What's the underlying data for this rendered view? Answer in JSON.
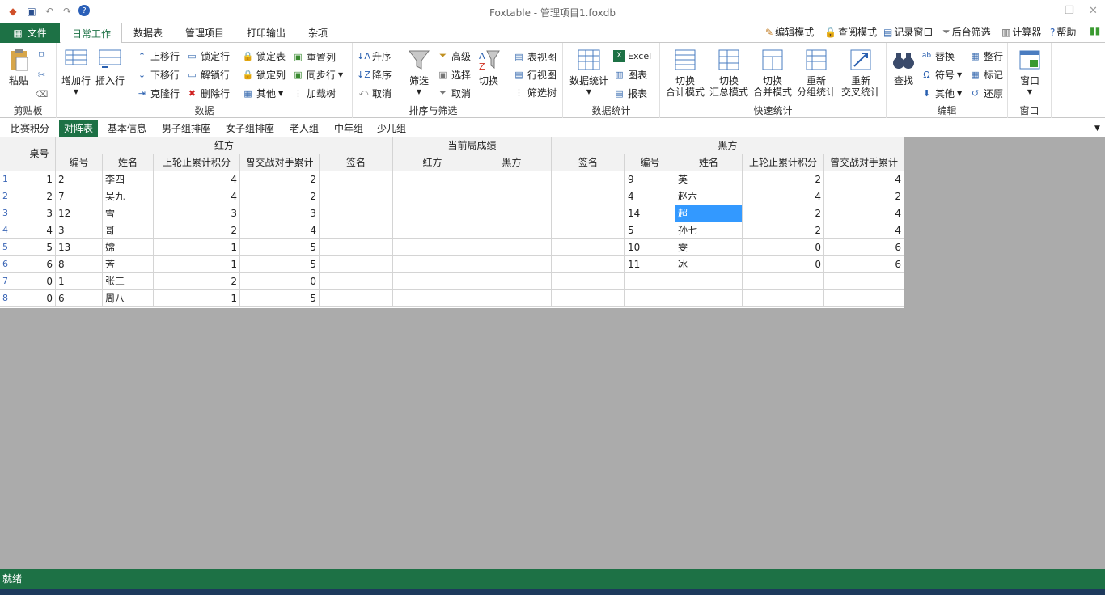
{
  "window": {
    "title": "Foxtable - 管理项目1.foxdb"
  },
  "menu": {
    "file": "文件",
    "tabs": [
      "日常工作",
      "数据表",
      "管理项目",
      "打印输出",
      "杂项"
    ]
  },
  "right_links": [
    "编辑模式",
    "查阅模式",
    "记录窗口",
    "后台筛选",
    "计算器",
    "帮助"
  ],
  "ribbon": {
    "clipboard": {
      "label": "剪贴板",
      "paste": "粘贴"
    },
    "data": {
      "label": "数据",
      "add_row": "增加行",
      "insert_row": "插入行",
      "move_up": "上移行",
      "move_down": "下移行",
      "clone_row": "克隆行",
      "lock_row": "锁定行",
      "unlock_row": "解锁行",
      "delete_row": "删除行",
      "lock_table": "锁定表",
      "lock_col": "锁定列",
      "other": "其他",
      "reset_col": "重置列",
      "sync_row": "同步行",
      "load_tree": "加载树"
    },
    "sort": {
      "label": "排序与筛选",
      "asc": "升序",
      "desc": "降序",
      "cancel": "取消",
      "filter": "筛选",
      "advanced": "高级",
      "select": "选择",
      "cancel2": "取消",
      "switch": "切换"
    },
    "views": {
      "table_view": "表视图",
      "row_view": "行视图",
      "filter_tree": "筛选树"
    },
    "stats": {
      "label": "数据统计",
      "data_stats": "数据统计",
      "excel": "Excel",
      "chart": "图表",
      "report": "报表"
    },
    "quick": {
      "label": "快速统计",
      "b1": [
        "切换",
        "合计模式"
      ],
      "b2": [
        "切换",
        "汇总模式"
      ],
      "b3": [
        "切换",
        "合并模式"
      ],
      "b4": [
        "重新",
        "分组统计"
      ],
      "b5": [
        "重新",
        "交叉统计"
      ]
    },
    "edit": {
      "label": "编辑",
      "find": "查找",
      "replace": "替换",
      "symbol": "符号",
      "other": "其他",
      "tidy_row": "整行",
      "mark": "标记",
      "restore": "还原"
    },
    "window_grp": {
      "label": "窗口",
      "window": "窗口"
    }
  },
  "sheet_tabs": [
    "比赛积分",
    "对阵表",
    "基本信息",
    "男子组排座",
    "女子组排座",
    "老人组",
    "中年组",
    "少儿组"
  ],
  "table": {
    "group_headers": {
      "table_no": "桌号",
      "red": "红方",
      "current": "当前局成绩",
      "black": "黑方"
    },
    "sub_headers": {
      "red": [
        "编号",
        "姓名",
        "上轮止累计积分",
        "曾交战对手累计",
        "签名"
      ],
      "current": [
        "红方",
        "黑方"
      ],
      "black": [
        "签名",
        "编号",
        "姓名",
        "上轮止累计积分",
        "曾交战对手累计"
      ]
    },
    "rows": [
      {
        "rn": "1",
        "table": "1",
        "r_no": "2",
        "r_name": "李四",
        "r_score": "4",
        "r_opp": "2",
        "b_no": "9",
        "b_name": "英",
        "b_score": "2",
        "b_opp": "4"
      },
      {
        "rn": "2",
        "table": "2",
        "r_no": "7",
        "r_name": "吴九",
        "r_score": "4",
        "r_opp": "2",
        "b_no": "4",
        "b_name": "赵六",
        "b_score": "4",
        "b_opp": "2"
      },
      {
        "rn": "3",
        "table": "3",
        "r_no": "12",
        "r_name": "雪",
        "r_score": "3",
        "r_opp": "3",
        "b_no": "14",
        "b_name": "超",
        "b_score": "2",
        "b_opp": "4"
      },
      {
        "rn": "4",
        "table": "4",
        "r_no": "3",
        "r_name": "哥",
        "r_score": "2",
        "r_opp": "4",
        "b_no": "5",
        "b_name": "孙七",
        "b_score": "2",
        "b_opp": "4"
      },
      {
        "rn": "5",
        "table": "5",
        "r_no": "13",
        "r_name": "嫦",
        "r_score": "1",
        "r_opp": "5",
        "b_no": "10",
        "b_name": "雯",
        "b_score": "0",
        "b_opp": "6"
      },
      {
        "rn": "6",
        "table": "6",
        "r_no": "8",
        "r_name": "芳",
        "r_score": "1",
        "r_opp": "5",
        "b_no": "11",
        "b_name": "冰",
        "b_score": "0",
        "b_opp": "6"
      },
      {
        "rn": "7",
        "table": "0",
        "r_no": "1",
        "r_name": "张三",
        "r_score": "2",
        "r_opp": "0",
        "b_no": "",
        "b_name": "",
        "b_score": "",
        "b_opp": ""
      },
      {
        "rn": "8",
        "table": "0",
        "r_no": "6",
        "r_name": "周八",
        "r_score": "1",
        "r_opp": "5",
        "b_no": "",
        "b_name": "",
        "b_score": "",
        "b_opp": ""
      }
    ]
  },
  "status": {
    "text": "就绪"
  },
  "colors": {
    "accent": "#1d7145",
    "selection": "#3399ff"
  }
}
